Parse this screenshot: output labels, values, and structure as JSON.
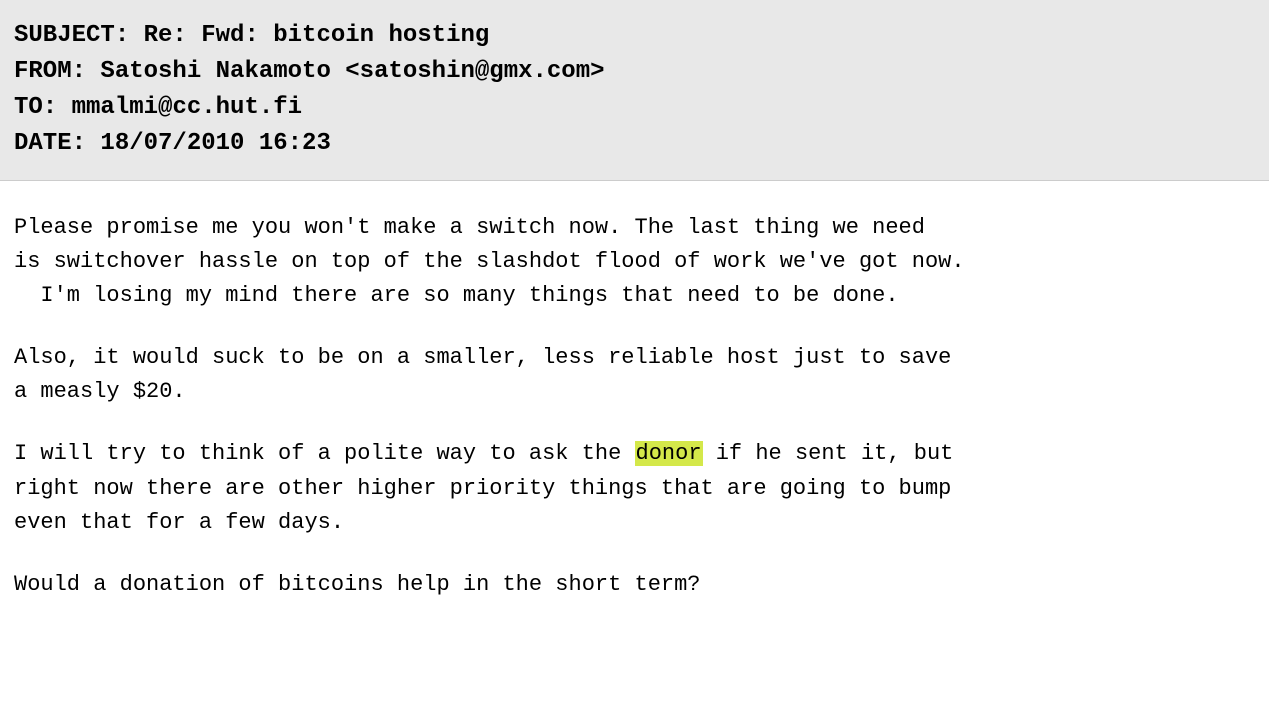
{
  "header": {
    "subject_label": "SUBJECT:",
    "subject_value": "Re: Fwd: bitcoin hosting",
    "from_label": "FROM:",
    "from_value": "Satoshi Nakamoto <satoshin@gmx.com>",
    "to_label": "TO:",
    "to_value": "mmalmi@cc.hut.fi",
    "date_label": "DATE:",
    "date_value": "18/07/2010 16:23"
  },
  "body": {
    "paragraph1": "Please promise me you won't make a switch now.  The last thing we need\nis switchover hassle on top of the slashdot flood of work we've got now.\n  I'm losing my mind there are so many things that need to be done.",
    "paragraph2": "Also, it would suck to be on a smaller, less reliable host just to save\na measly $20.",
    "paragraph3_pre": "I will try to think of a polite way to ask the ",
    "paragraph3_highlight": "donor",
    "paragraph3_post": " if he sent it, but\nright now there are other higher priority things that are going to bump\neven that for a few days.",
    "paragraph4": "Would a donation of bitcoins help in the short term?"
  },
  "colors": {
    "header_bg": "#e8e8e8",
    "highlight": "#d4e84a",
    "text": "#000000",
    "body_bg": "#ffffff"
  }
}
